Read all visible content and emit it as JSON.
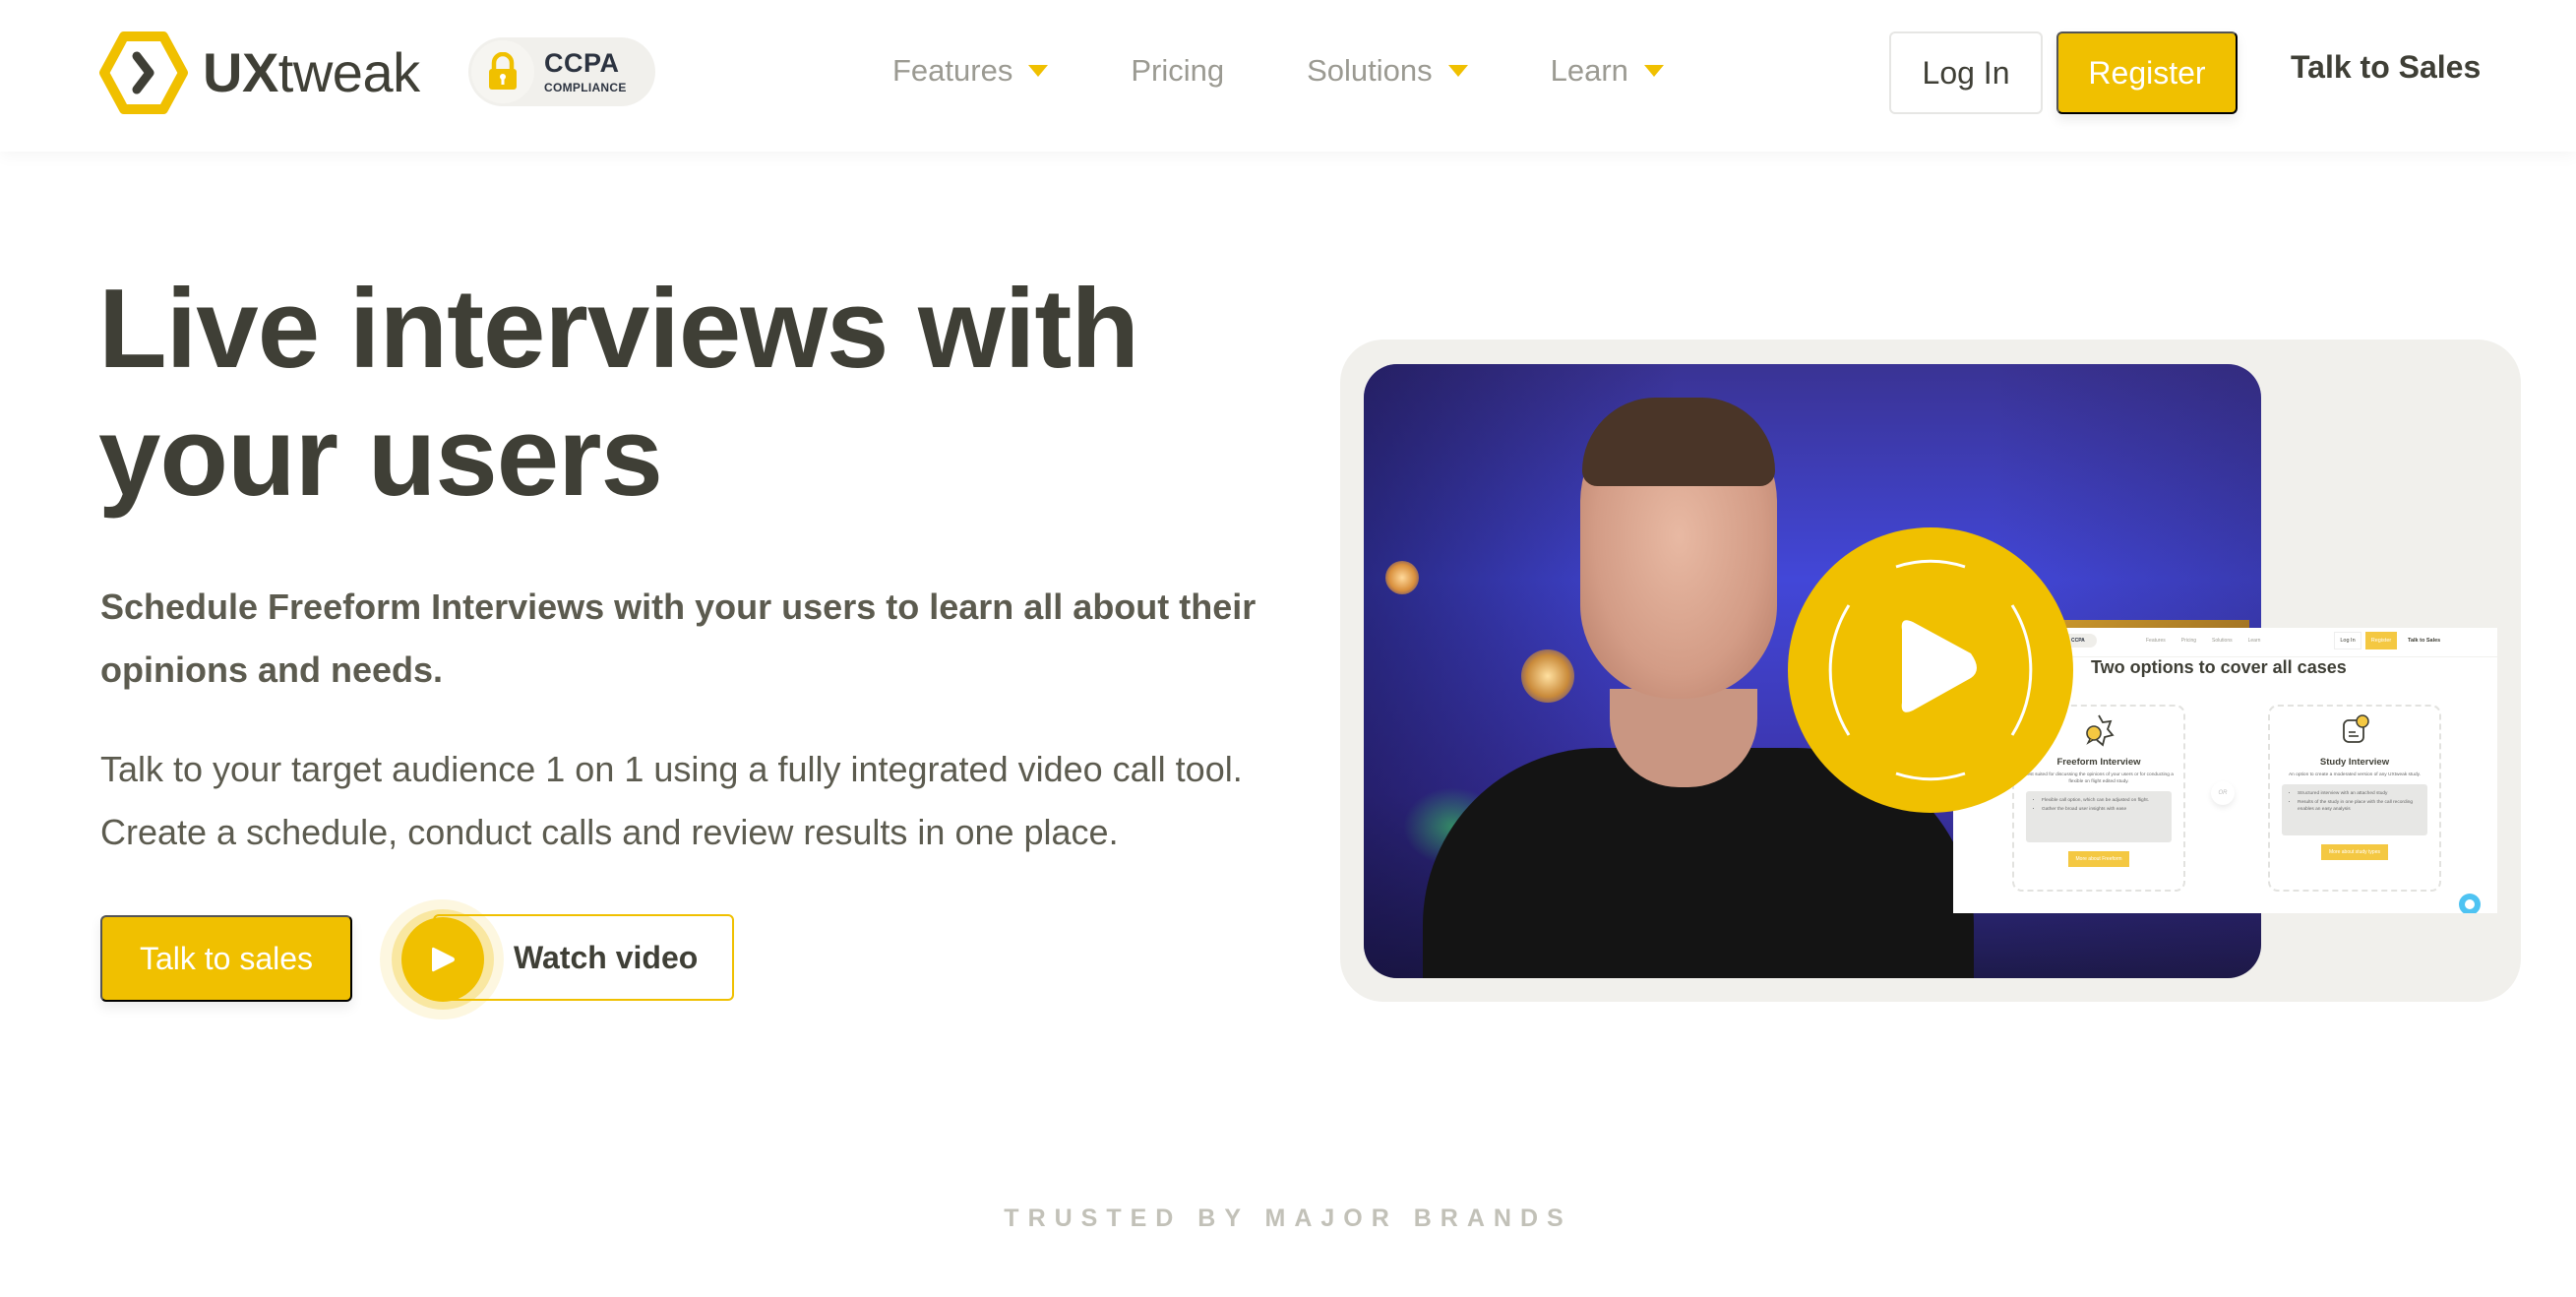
{
  "header": {
    "logo": {
      "bold": "UX",
      "regular": "tweak",
      "icon": "hexagon-chevron-logo-icon"
    },
    "badge": {
      "title": "CCPA",
      "subtitle": "COMPLIANCE",
      "icon": "padlock-icon"
    },
    "nav": [
      {
        "label": "Features",
        "has_dropdown": true
      },
      {
        "label": "Pricing",
        "has_dropdown": false
      },
      {
        "label": "Solutions",
        "has_dropdown": true
      },
      {
        "label": "Learn",
        "has_dropdown": true
      }
    ],
    "login_label": "Log In",
    "register_label": "Register",
    "sales_label": "Talk to Sales"
  },
  "hero": {
    "headline": "Live interviews with your users",
    "subheading": "Schedule Freeform Interviews with your users to learn all about their opinions and needs.",
    "body": "Talk to your target audience 1 on 1 using a fully integrated video call tool. Create a schedule, conduct calls and review results in one place.",
    "cta_primary": "Talk to sales",
    "cta_secondary": "Watch video"
  },
  "video": {
    "play_icon": "play-icon",
    "inset": {
      "header": {
        "badge_title": "CCPA",
        "nav": [
          "Features",
          "Pricing",
          "Solutions",
          "Learn"
        ],
        "login": "Log In",
        "register": "Register",
        "sales": "Talk to Sales"
      },
      "title": "Two options to cover all cases",
      "or_label": "OR",
      "cards": [
        {
          "title": "Freeform Interview",
          "description": "Best suited for discussing the opinions of your users or for conducting a flexible on flight edited study.",
          "bullets": [
            "Flexible call option, which can be adjusted on flight.",
            "Gather the broad user insights with ease"
          ],
          "button": "More about Freeform"
        },
        {
          "title": "Study Interview",
          "description": "An option to create a moderated version of any UXtweak study.",
          "bullets": [
            "Structured interview with an attached study",
            "Results of the study in one place with the call recording enables an easy analysis"
          ],
          "button": "More about study types"
        }
      ]
    }
  },
  "trusted_label": "TRUSTED BY MAJOR BRANDS",
  "colors": {
    "accent": "#f0c000",
    "text": "#3f3f36",
    "muted": "#9b9a92",
    "panel": "#f1f0ec"
  }
}
